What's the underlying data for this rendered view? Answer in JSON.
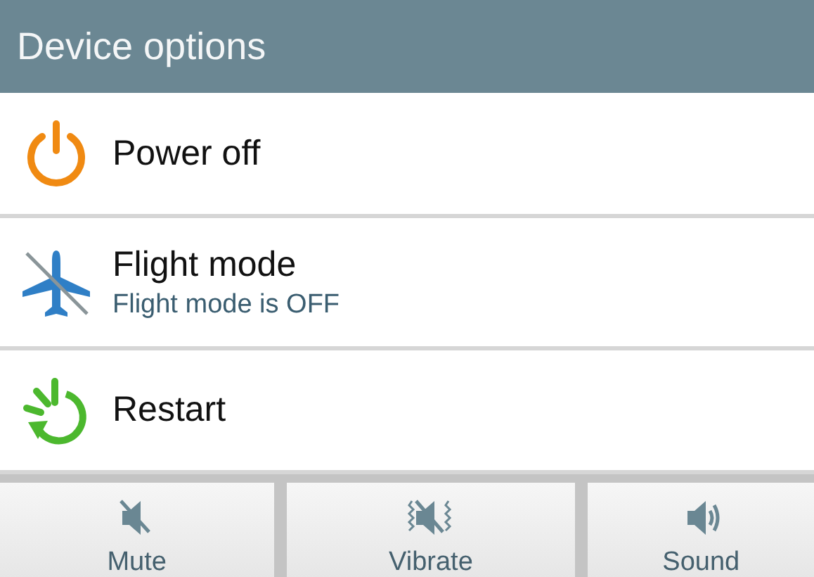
{
  "header": {
    "title": "Device options"
  },
  "options": [
    {
      "kind": "power",
      "label": "Power off"
    },
    {
      "kind": "flight",
      "label": "Flight mode",
      "subtitle": "Flight mode is OFF"
    },
    {
      "kind": "restart",
      "label": "Restart"
    }
  ],
  "sound_modes": [
    {
      "kind": "mute",
      "label": "Mute"
    },
    {
      "kind": "vibrate",
      "label": "Vibrate"
    },
    {
      "kind": "sound",
      "label": "Sound"
    }
  ]
}
